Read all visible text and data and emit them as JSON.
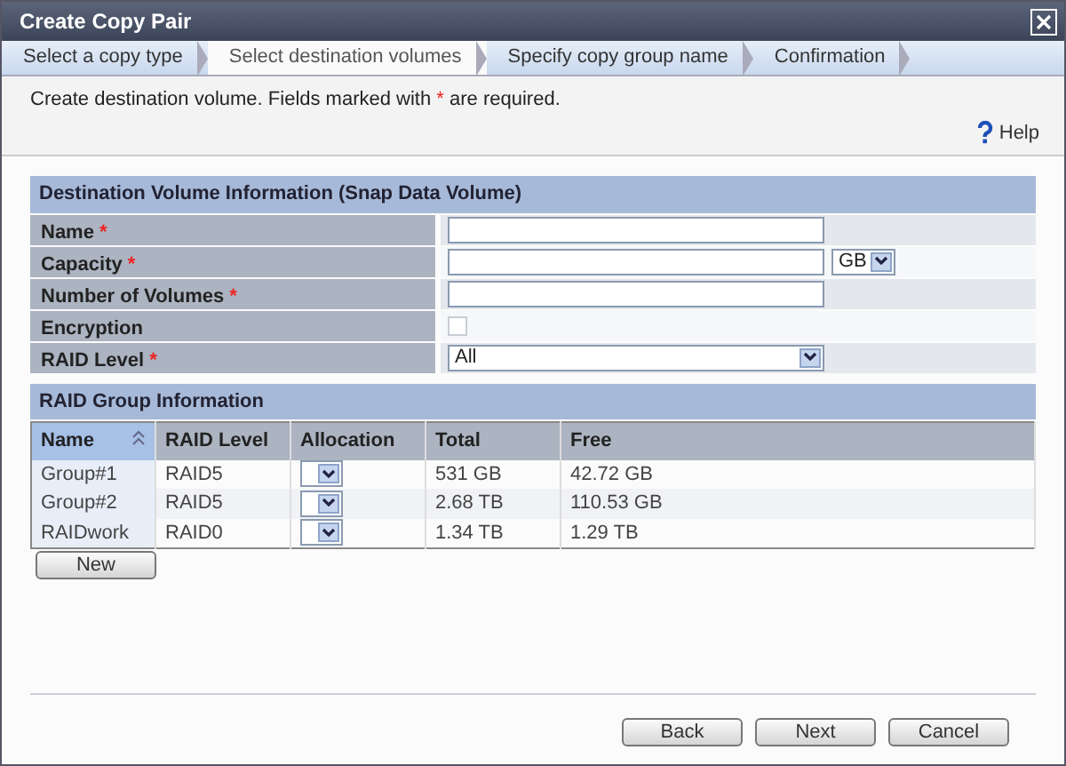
{
  "window": {
    "title": "Create Copy Pair"
  },
  "steps": [
    {
      "label": "Select a copy type",
      "selected": false
    },
    {
      "label": "Select destination volumes",
      "selected": true
    },
    {
      "label": "Specify copy group name",
      "selected": false
    },
    {
      "label": "Confirmation",
      "selected": false
    }
  ],
  "instruction": {
    "before": "Create destination volume. Fields marked with",
    "mark": "*",
    "after": "are required."
  },
  "help": {
    "label": "Help"
  },
  "volume_section": {
    "title": "Destination Volume Information (Snap Data Volume)",
    "fields": [
      {
        "kind": "text",
        "label": "Name",
        "required_mark": "*"
      },
      {
        "kind": "text_unit",
        "label": "Capacity",
        "required_mark": "*",
        "unit": "GB"
      },
      {
        "kind": "text",
        "label": "Number of Volumes",
        "required_mark": "*"
      },
      {
        "kind": "checkbox",
        "label": "Encryption",
        "checked": false
      },
      {
        "kind": "select",
        "label": "RAID Level",
        "required_mark": "*",
        "value": "All"
      }
    ]
  },
  "raid_section": {
    "title": "RAID Group Information",
    "columns": [
      {
        "label": "Name",
        "sorted": true
      },
      {
        "label": "RAID Level",
        "sorted": false
      },
      {
        "label": "Allocation",
        "sorted": false
      },
      {
        "label": "Total",
        "sorted": false
      },
      {
        "label": "Free",
        "sorted": false
      }
    ],
    "rows": [
      {
        "name": "Group#1",
        "raid_level": "RAID5",
        "total": "531 GB",
        "free": "42.72 GB"
      },
      {
        "name": "Group#2",
        "raid_level": "RAID5",
        "total": "2.68 TB",
        "free": "110.53 GB"
      },
      {
        "name": "RAIDwork",
        "raid_level": "RAID0",
        "total": "1.34 TB",
        "free": "1.29 TB"
      }
    ],
    "new_button": "New"
  },
  "buttons": [
    "Back",
    "Next",
    "Cancel"
  ]
}
